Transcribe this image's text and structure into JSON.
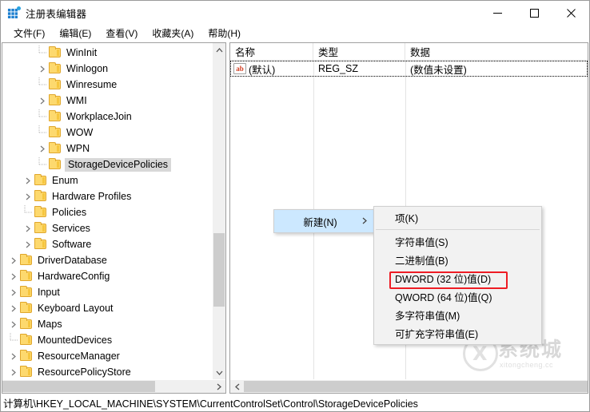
{
  "window": {
    "title": "注册表编辑器",
    "app_icon": "registry-editor-icon",
    "minimize_label": "最小化",
    "maximize_label": "最大化",
    "close_label": "关闭"
  },
  "menubar": {
    "items": [
      {
        "label": "文件(F)"
      },
      {
        "label": "编辑(E)"
      },
      {
        "label": "查看(V)"
      },
      {
        "label": "收藏夹(A)"
      },
      {
        "label": "帮助(H)"
      }
    ]
  },
  "tree": {
    "items": [
      {
        "label": "WinInit",
        "indent": 3,
        "expandable": false,
        "selected": false
      },
      {
        "label": "Winlogon",
        "indent": 3,
        "expandable": true,
        "selected": false
      },
      {
        "label": "Winresume",
        "indent": 3,
        "expandable": false,
        "selected": false
      },
      {
        "label": "WMI",
        "indent": 3,
        "expandable": true,
        "selected": false
      },
      {
        "label": "WorkplaceJoin",
        "indent": 3,
        "expandable": false,
        "selected": false
      },
      {
        "label": "WOW",
        "indent": 3,
        "expandable": false,
        "selected": false
      },
      {
        "label": "WPN",
        "indent": 3,
        "expandable": true,
        "selected": false
      },
      {
        "label": "StorageDevicePolicies",
        "indent": 3,
        "expandable": false,
        "selected": true
      },
      {
        "label": "Enum",
        "indent": 2,
        "expandable": true,
        "selected": false
      },
      {
        "label": "Hardware Profiles",
        "indent": 2,
        "expandable": true,
        "selected": false
      },
      {
        "label": "Policies",
        "indent": 2,
        "expandable": false,
        "selected": false
      },
      {
        "label": "Services",
        "indent": 2,
        "expandable": true,
        "selected": false
      },
      {
        "label": "Software",
        "indent": 2,
        "expandable": true,
        "selected": false
      },
      {
        "label": "DriverDatabase",
        "indent": 1,
        "expandable": true,
        "selected": false
      },
      {
        "label": "HardwareConfig",
        "indent": 1,
        "expandable": true,
        "selected": false
      },
      {
        "label": "Input",
        "indent": 1,
        "expandable": true,
        "selected": false
      },
      {
        "label": "Keyboard Layout",
        "indent": 1,
        "expandable": true,
        "selected": false
      },
      {
        "label": "Maps",
        "indent": 1,
        "expandable": true,
        "selected": false
      },
      {
        "label": "MountedDevices",
        "indent": 1,
        "expandable": false,
        "selected": false
      },
      {
        "label": "ResourceManager",
        "indent": 1,
        "expandable": true,
        "selected": false
      },
      {
        "label": "ResourcePolicyStore",
        "indent": 1,
        "expandable": true,
        "selected": false
      }
    ]
  },
  "values": {
    "columns": [
      "名称",
      "类型",
      "数据"
    ],
    "rows": [
      {
        "icon": "ab-string-icon",
        "name": "(默认)",
        "type": "REG_SZ",
        "data": "(数值未设置)"
      }
    ]
  },
  "context_menu": {
    "new_label": "新建(N)",
    "submenu_arrow": "chevron-right-icon",
    "submenu": [
      {
        "label": "项(K)",
        "separator_after": true,
        "highlighted": false
      },
      {
        "label": "字符串值(S)",
        "separator_after": false,
        "highlighted": false
      },
      {
        "label": "二进制值(B)",
        "separator_after": false,
        "highlighted": false
      },
      {
        "label": "DWORD (32 位)值(D)",
        "separator_after": false,
        "highlighted": true
      },
      {
        "label": "QWORD (64 位)值(Q)",
        "separator_after": false,
        "highlighted": false
      },
      {
        "label": "多字符串值(M)",
        "separator_after": false,
        "highlighted": false
      },
      {
        "label": "可扩充字符串值(E)",
        "separator_after": false,
        "highlighted": false
      }
    ]
  },
  "statusbar": {
    "path": "计算机\\HKEY_LOCAL_MACHINE\\SYSTEM\\CurrentControlSet\\Control\\StorageDevicePolicies"
  },
  "watermark": {
    "title": "系统城",
    "url": "xitongcheng.cc"
  },
  "colors": {
    "menu_highlight": "#cce8ff",
    "annotation_red": "#ee1c24",
    "selection_gray": "#d8d8d8",
    "folder_yellow": "#fdd96e"
  }
}
